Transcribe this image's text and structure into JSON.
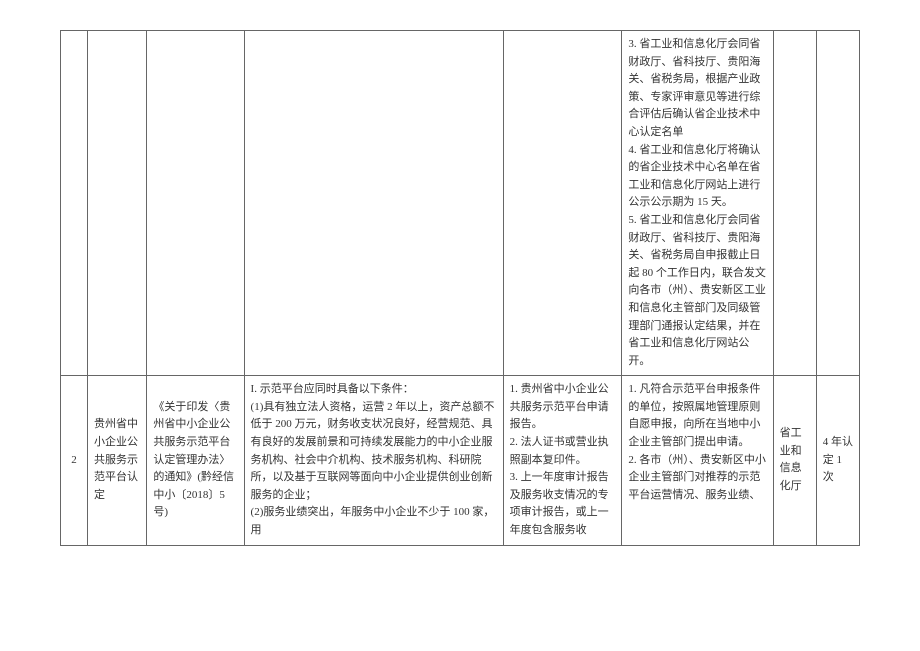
{
  "row1": {
    "col6_text": "3. 省工业和信息化厅会同省财政厅、省科技厅、贵阳海关、省税务局，根据产业政策、专家评审意见等进行综合评估后确认省企业技术中心认定名单\n4. 省工业和信息化厅将确认的省企业技术中心名单在省工业和信息化厅网站上进行公示公示期为 15 天。\n5. 省工业和信息化厅会同省财政厅、省科技厅、贵阳海关、省税务局自申报截止日起 80 个工作日内，联合发文向各市（州）、贵安新区工业和信息化主管部门及同级管理部门通报认定结果，并在省工业和信息化厅网站公开。"
  },
  "row2": {
    "index": "2",
    "col2": "贵州省中小企业公共服务示范平台认定",
    "col3": "《关于印发〈贵州省中小企业公共服务示范平台认定管理办法〉的通知》(黔经信中小〔2018〕5 号)",
    "col4": "I. 示范平台应同时具备以下条件：\n(1)具有独立法人资格，运营 2 年以上，资产总额不低于 200 万元，财务收支状况良好，经营规范、具有良好的发展前景和可持续发展能力的中小企业服务机构、社会中介机构、技术服务机构、科研院所，以及基于互联网等面向中小企业提供创业创新服务的企业；\n(2)服务业绩突出，年服务中小企业不少于 100 家，用",
    "col5": "1. 贵州省中小企业公共服务示范平台申请报告。\n2. 法人证书或营业执照副本复印件。\n3. 上一年度审计报告及服务收支情况的专项审计报告，或上一年度包含服务收",
    "col6": "1. 凡符合示范平台申报条件的单位，按照属地管理原则自愿申报，向所在当地中小企业主管部门提出申请。\n2. 各市（州）、贵安新区中小企业主管部门对推荐的示范平台运营情况、服务业绩、",
    "col7": "省工业和信息化厅",
    "col8": "4 年认定 1 次"
  }
}
